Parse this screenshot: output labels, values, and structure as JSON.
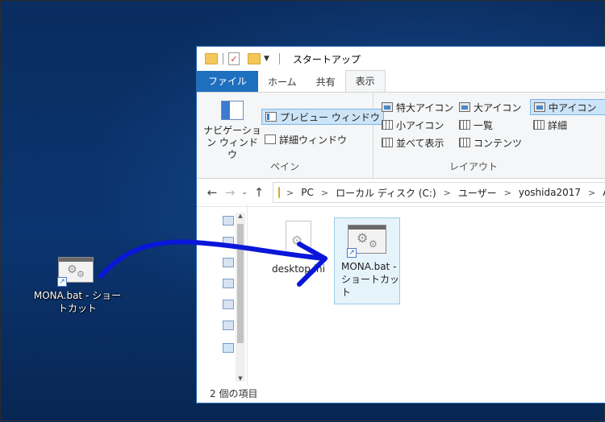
{
  "desktop": {
    "icon_label": "MONA.bat - ショートカット"
  },
  "window": {
    "title": "スタートアップ",
    "quick_access": [
      "folder-icon",
      "properties-check-icon",
      "new-folder-icon",
      "customize-arrow"
    ],
    "tabs": [
      "ファイル",
      "ホーム",
      "共有",
      "表示"
    ],
    "active_tab": "表示"
  },
  "ribbon": {
    "pane_group": {
      "nav_pane_label": "ナビゲーション ウィンドウ",
      "preview_label": "プレビュー ウィンドウ",
      "details_label": "詳細ウィンドウ",
      "group_label": "ペイン"
    },
    "layout_group": {
      "items": [
        "特大アイコン",
        "大アイコン",
        "中アイコン",
        "小アイコン",
        "一覧",
        "詳細",
        "並べて表示",
        "コンテンツ"
      ],
      "selected": "中アイコン",
      "group_label": "レイアウト"
    }
  },
  "address": {
    "crumbs": [
      "PC",
      "ローカル ディスク (C:)",
      "ユーザー",
      "yoshida2017"
    ],
    "truncated": "A"
  },
  "files": [
    {
      "name": "desktop.ini",
      "display": "desktop.ini"
    },
    {
      "name": "MONA.bat - ショートカット",
      "display": "MONA.bat - ショートカット"
    }
  ],
  "status": {
    "item_count": "2 個の項目"
  },
  "colors": {
    "accent": "#1f6fbf",
    "drag_arrow": "#0a16d8",
    "selection": "#e5f3fb"
  }
}
